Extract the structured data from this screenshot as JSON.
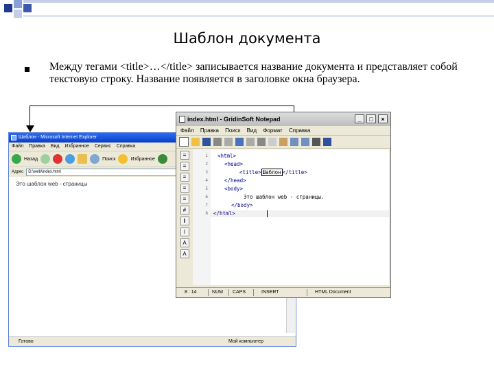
{
  "slide": {
    "title": "Шаблон документа",
    "body": "Между тегами <title>…</title> записывается название документа и представляет собой текстовую строку. Название появляется в заголовке окна браузера."
  },
  "ie": {
    "title": "Шаблон - Microsoft Internet Explorer",
    "menu": [
      "Файл",
      "Правка",
      "Вид",
      "Избранное",
      "Сервис",
      "Справка"
    ],
    "toolbar": {
      "back": "Назад",
      "search": "Поиск",
      "favorites": "Избранное"
    },
    "address_label": "Адрес",
    "address_value": "D:\\web\\index.html",
    "page_text": "Это шаблон web - страницы",
    "status_left": "Готово",
    "status_right": "Мой компьютер"
  },
  "notepad": {
    "title": "index.html - GridinSoft Notepad",
    "menu": [
      "Файл",
      "Правка",
      "Поиск",
      "Вид",
      "Формат",
      "Справка"
    ],
    "line_numbers": [
      "1",
      "2",
      "3",
      "4",
      "5",
      "6",
      "7",
      "8"
    ],
    "code": {
      "l1": "<html>",
      "l2": "<head>",
      "l3_open": "<title>",
      "l3_title": "Шаблон",
      "l3_close": "</title>",
      "l4": "</head>",
      "l5": "<body>",
      "l6": "Это шаблон web - страницы.",
      "l7": "</body>",
      "l8": "</html>"
    },
    "status": {
      "pos": "8 : 14",
      "num": "NUM",
      "caps": "CAPS",
      "insert": "INSERT",
      "doc": "HTML Document"
    }
  },
  "colors": {
    "ie_titlebar": "#0a3dc7",
    "tag_color": "#000080",
    "deco_blue": "#1f3a8f"
  }
}
